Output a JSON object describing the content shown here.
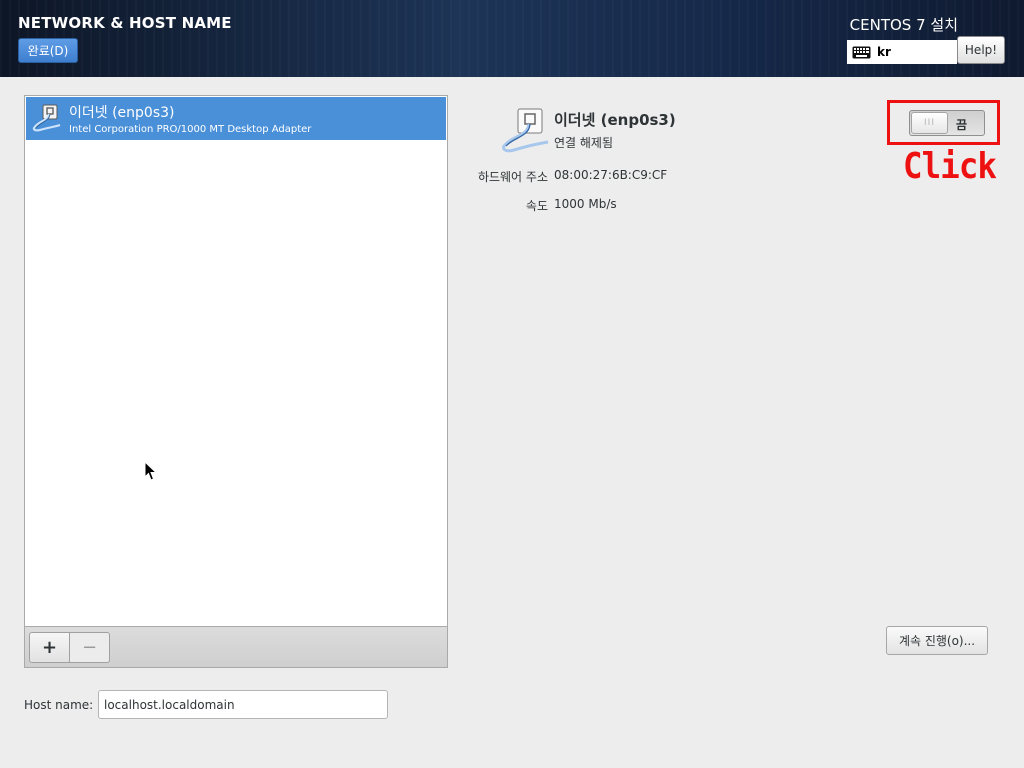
{
  "header": {
    "spoke_title": "NETWORK & HOST NAME",
    "done_label": "완료(D)",
    "product_title": "CENTOS 7 설치",
    "keyboard_layout": "kr",
    "help_label": "Help!"
  },
  "device_list": {
    "items": [
      {
        "name": "이더넷 (enp0s3)",
        "description": "Intel Corporation PRO/1000 MT Desktop Adapter",
        "icon": "ethernet-cable-icon",
        "selected": true
      }
    ],
    "add_label": "+",
    "remove_label": "−"
  },
  "host": {
    "label": "Host name:",
    "value": "localhost.localdomain"
  },
  "detail": {
    "name": "이더넷 (enp0s3)",
    "status": "연결 해제됨",
    "fields": [
      {
        "label": "하드웨어 주소",
        "value": "08:00:27:6B:C9:CF"
      },
      {
        "label": "속도",
        "value": "1000 Mb/s"
      }
    ],
    "toggle_state": "끔",
    "toggle_knob": "III",
    "configure_label": "계속 진행(o)..."
  },
  "annotation": {
    "text": "Click",
    "color": "#ee1111"
  },
  "colors": {
    "selection": "#4a90d9",
    "header_bg": "#1d3456",
    "window_bg": "#ededed"
  }
}
